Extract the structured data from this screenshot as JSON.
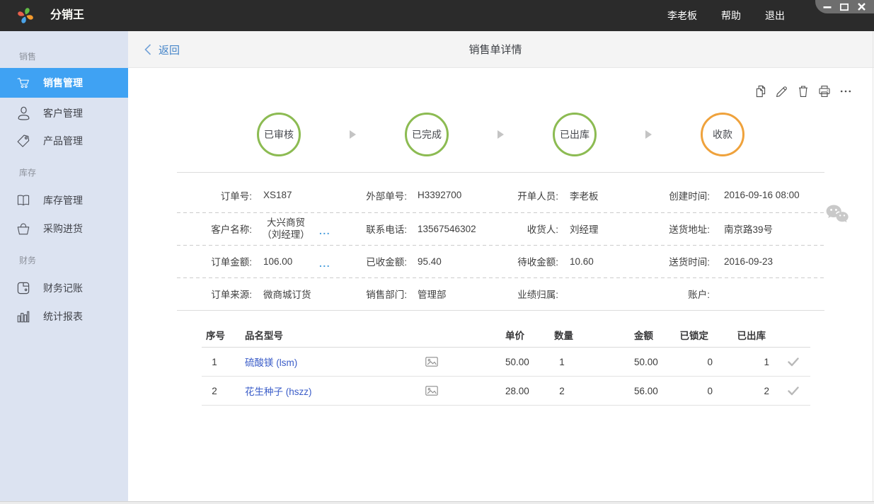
{
  "colors": {
    "accent_blue": "#3fa2f3",
    "step_green": "#8cbb52",
    "step_orange": "#efa23c",
    "link_blue": "#3a5cc8"
  },
  "topbar": {
    "app_title": "分销王",
    "user": "李老板",
    "help": "帮助",
    "logout": "退出"
  },
  "sidebar": {
    "sections": [
      {
        "label": "销售",
        "items": [
          {
            "label": "销售管理"
          },
          {
            "label": "客户管理"
          },
          {
            "label": "产品管理"
          }
        ]
      },
      {
        "label": "库存",
        "items": [
          {
            "label": "库存管理"
          },
          {
            "label": "采购进货"
          }
        ]
      },
      {
        "label": "财务",
        "items": [
          {
            "label": "财务记账"
          },
          {
            "label": "统计报表"
          }
        ]
      }
    ]
  },
  "header": {
    "back_label": "返回",
    "title": "销售单详情"
  },
  "steps": [
    {
      "label": "已审核",
      "color": "green"
    },
    {
      "label": "已完成",
      "color": "green"
    },
    {
      "label": "已出库",
      "color": "green"
    },
    {
      "label": "收款",
      "color": "orange"
    }
  ],
  "details": {
    "rows": [
      {
        "fields": [
          {
            "label": "订单号:",
            "value": "XS187"
          },
          {
            "label": "外部单号:",
            "value": "H3392700"
          },
          {
            "label": "开单人员:",
            "value": "李老板"
          },
          {
            "label": "创建时间:",
            "value": "2016-09-16 08:00"
          }
        ]
      },
      {
        "fields": [
          {
            "label": "客户名称:",
            "value": "大兴商贸",
            "value2": "（刘经理）",
            "more": "..."
          },
          {
            "label": "联系电话:",
            "value": "13567546302"
          },
          {
            "label": "收货人:",
            "value": "刘经理"
          },
          {
            "label": "送货地址:",
            "value": "南京路39号"
          }
        ]
      },
      {
        "fields": [
          {
            "label": "订单金额:",
            "value": "106.00",
            "more": "..."
          },
          {
            "label": "已收金额:",
            "value": "95.40"
          },
          {
            "label": "待收金额:",
            "value": "10.60"
          },
          {
            "label": "送货时间:",
            "value": "2016-09-23"
          }
        ]
      },
      {
        "fields": [
          {
            "label": "订单来源:",
            "value": "微商城订货"
          },
          {
            "label": "销售部门:",
            "value": "管理部"
          },
          {
            "label": "业绩归属:",
            "value": ""
          },
          {
            "label": "账户:",
            "value": ""
          }
        ]
      }
    ]
  },
  "items_table": {
    "headers": {
      "index": "序号",
      "name": "品名型号",
      "unit_price": "单价",
      "quantity": "数量",
      "amount": "金额",
      "locked": "已锁定",
      "shipped": "已出库"
    },
    "rows": [
      {
        "index": "1",
        "name": "硫酸镁 (lsm)",
        "unit_price": "50.00",
        "quantity": "1",
        "amount": "50.00",
        "locked": "0",
        "shipped": "1"
      },
      {
        "index": "2",
        "name": "花生种子 (hszz)",
        "unit_price": "28.00",
        "quantity": "2",
        "amount": "56.00",
        "locked": "0",
        "shipped": "2"
      }
    ]
  }
}
